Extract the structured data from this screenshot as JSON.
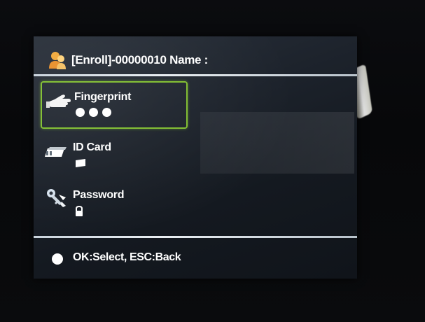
{
  "header": {
    "icon": "user-enroll-icon",
    "title": "[Enroll]-00000010 Name :"
  },
  "options": [
    {
      "label": "Fingerprint",
      "icon": "fingerprint-hand-icon",
      "status_icon": "three-dots",
      "selected": true
    },
    {
      "label": "ID Card",
      "icon": "id-card-icon",
      "status_icon": "card-small-icon",
      "selected": false
    },
    {
      "label": "Password",
      "icon": "password-key-icon",
      "status_icon": "lock-small-icon",
      "selected": false
    }
  ],
  "footer": {
    "hint": "OK:Select, ESC:Back"
  },
  "colors": {
    "selection_border": "#7fbd2e",
    "text": "#ffffff",
    "screen_bg": "#1d232c"
  }
}
